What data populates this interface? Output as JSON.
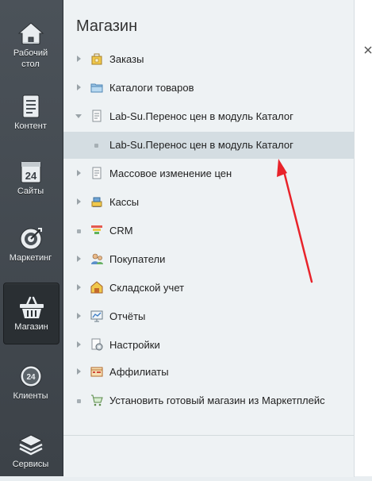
{
  "rail": {
    "items": [
      {
        "label": "Рабочий\nстол",
        "icon": "home-icon"
      },
      {
        "label": "Контент",
        "icon": "document-icon"
      },
      {
        "label": "Сайты",
        "icon": "calendar-24-icon"
      },
      {
        "label": "Маркетинг",
        "icon": "target-icon"
      },
      {
        "label": "Магазин",
        "icon": "basket-icon"
      },
      {
        "label": "Клиенты",
        "icon": "cloud-24-icon"
      },
      {
        "label": "Сервисы",
        "icon": "layers-icon"
      }
    ],
    "active_index": 4
  },
  "panel": {
    "title": "Магазин",
    "items": [
      {
        "label": "Заказы",
        "icon": "orders-icon",
        "marker": "arrow-right"
      },
      {
        "label": "Каталоги товаров",
        "icon": "folder-icon",
        "marker": "arrow-right"
      },
      {
        "label": "Lab-Su.Перенос цен в модуль Каталог",
        "icon": "page-icon",
        "marker": "arrow-down"
      },
      {
        "label": "Lab-Su.Перенос цен в модуль Каталог",
        "icon": "",
        "marker": "dot",
        "selected": true,
        "sub": true
      },
      {
        "label": "Массовое изменение цен",
        "icon": "page-icon",
        "marker": "arrow-right"
      },
      {
        "label": "Кассы",
        "icon": "cash-register-icon",
        "marker": "arrow-right"
      },
      {
        "label": "CRM",
        "icon": "crm-funnel-icon",
        "marker": "dot"
      },
      {
        "label": "Покупатели",
        "icon": "customers-icon",
        "marker": "arrow-right"
      },
      {
        "label": "Складской учет",
        "icon": "warehouse-icon",
        "marker": "arrow-right"
      },
      {
        "label": "Отчёты",
        "icon": "reports-icon",
        "marker": "arrow-right"
      },
      {
        "label": "Настройки",
        "icon": "settings-icon",
        "marker": "arrow-right"
      },
      {
        "label": "Аффилиаты",
        "icon": "affiliates-icon",
        "marker": "arrow-right"
      },
      {
        "label": "Установить готовый магазин из Маркетплейс",
        "icon": "cart-icon",
        "marker": "dot"
      }
    ]
  },
  "annotation": {
    "color": "#e8232a"
  }
}
